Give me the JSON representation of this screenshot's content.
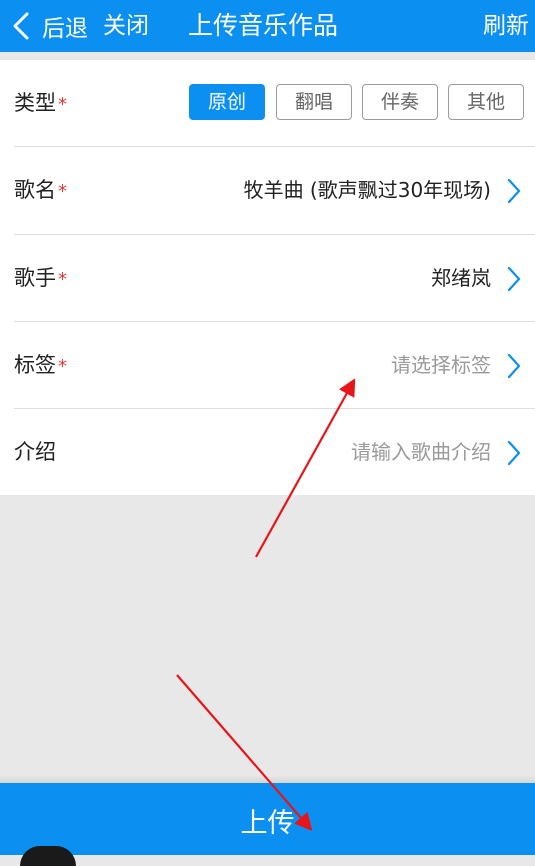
{
  "header": {
    "back_label": "后退",
    "close_label": "关闭",
    "title": "上传音乐作品",
    "refresh_label": "刷新"
  },
  "form": {
    "type": {
      "label": "类型",
      "required_mark": "*",
      "options": [
        "原创",
        "翻唱",
        "伴奏",
        "其他"
      ],
      "selected": "原创"
    },
    "song_name": {
      "label": "歌名",
      "required_mark": "*",
      "value": "牧羊曲 (歌声飘过30年现场)"
    },
    "singer": {
      "label": "歌手",
      "required_mark": "*",
      "value": "郑绪岚"
    },
    "tags": {
      "label": "标签",
      "required_mark": "*",
      "placeholder": "请选择标签"
    },
    "intro": {
      "label": "介绍",
      "placeholder": "请输入歌曲介绍"
    }
  },
  "upload_button": {
    "label": "上传"
  },
  "colors": {
    "brand": "#0b8ff0",
    "required": "#e53935",
    "annotation_arrow": "#e8141a"
  },
  "icons": [
    "chevron-left-icon",
    "chevron-right-icon"
  ]
}
